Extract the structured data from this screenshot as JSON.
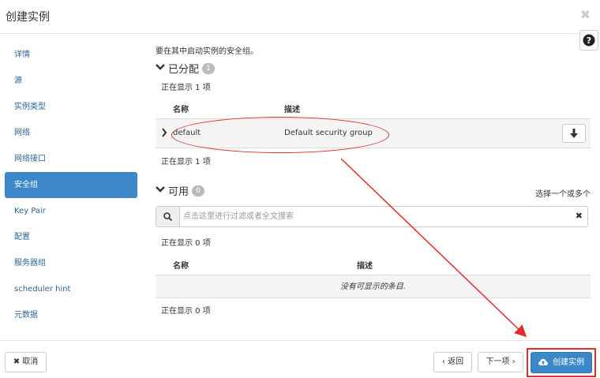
{
  "modal": {
    "title": "创建实例"
  },
  "sidebar": {
    "items": [
      {
        "label": "详情"
      },
      {
        "label": "源"
      },
      {
        "label": "实例类型"
      },
      {
        "label": "网络"
      },
      {
        "label": "网络接口"
      },
      {
        "label": "安全组",
        "active": true
      },
      {
        "label": "Key Pair"
      },
      {
        "label": "配置"
      },
      {
        "label": "服务器组"
      },
      {
        "label": "scheduler hint"
      },
      {
        "label": "元数据"
      }
    ]
  },
  "main": {
    "intro": "要在其中启动实例的安全组。",
    "allocated": {
      "title": "已分配",
      "count": "1",
      "showing_top": "正在显示 1 项",
      "showing_bottom": "正在显示 1 项",
      "columns": {
        "name": "名称",
        "description": "描述"
      },
      "rows": [
        {
          "name": "default",
          "description": "Default security group"
        }
      ]
    },
    "available": {
      "title": "可用",
      "count": "0",
      "select_hint": "选择一个或多个",
      "filter_placeholder": "点击这里进行过滤或者全文搜索",
      "showing_top": "正在显示 0 项",
      "showing_bottom": "正在显示 0 项",
      "columns": {
        "name": "名称",
        "description": "描述"
      },
      "empty_text": "没有可显示的条目."
    }
  },
  "footer": {
    "cancel_label": "取消",
    "back_label": "‹ 返回",
    "next_label": "下一项 ›",
    "launch_label": "创建实例"
  },
  "colors": {
    "primary": "#3b87c8",
    "annotation": "#e02d2d"
  }
}
